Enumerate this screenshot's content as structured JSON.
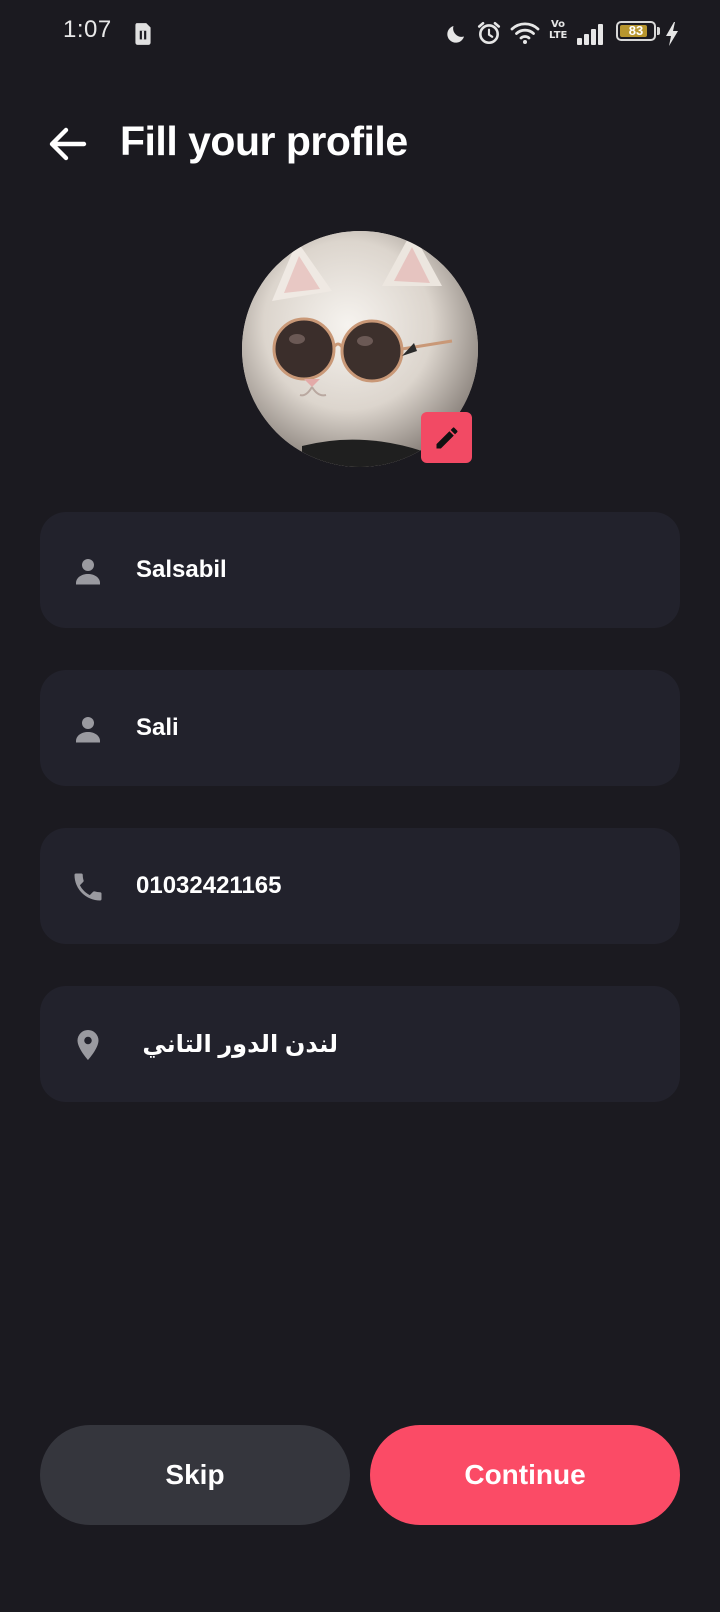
{
  "status_bar": {
    "time": "1:07",
    "battery_level": "83",
    "battery_fraction": 0.83,
    "icons": [
      "sim-card-icon",
      "moon-icon",
      "alarm-icon",
      "wifi-icon",
      "volte-icon",
      "signal-icon",
      "battery-icon",
      "charging-icon"
    ],
    "volte_label_top": "Vo",
    "volte_label_bottom": "LTE"
  },
  "header": {
    "title": "Fill your profile",
    "back_icon": "arrow-left-icon"
  },
  "avatar": {
    "edit_icon": "pencil-icon",
    "accent_color": "#f24a64"
  },
  "form": {
    "fields": [
      {
        "name": "full-name",
        "icon": "person-icon",
        "value": "Salsabil"
      },
      {
        "name": "nickname",
        "icon": "person-icon",
        "value": "Sali"
      },
      {
        "name": "phone",
        "icon": "phone-icon",
        "value": "01032421165"
      },
      {
        "name": "address",
        "icon": "location-pin-icon",
        "value": "لندن الدور التاني"
      }
    ]
  },
  "actions": {
    "skip_label": "Skip",
    "continue_label": "Continue",
    "continue_color": "#fb4b66",
    "skip_color": "#35363d"
  },
  "colors": {
    "background": "#1b1a20",
    "field_background": "#22222c",
    "icon_gray": "#9a9aa0"
  }
}
